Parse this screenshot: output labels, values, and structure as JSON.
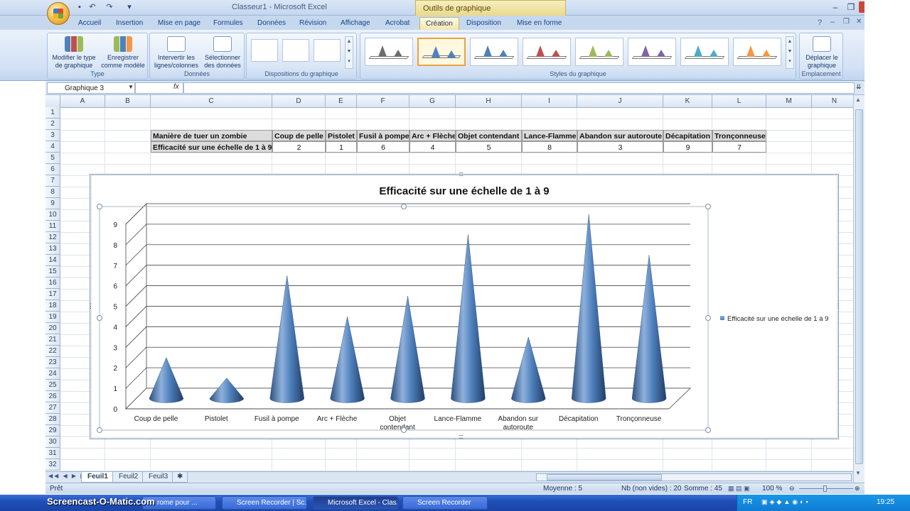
{
  "window": {
    "title": "Classeur1 - Microsoft Excel",
    "tools_title": "Outils de graphique"
  },
  "tabs": [
    "Accueil",
    "Insertion",
    "Mise en page",
    "Formules",
    "Données",
    "Révision",
    "Affichage",
    "Acrobat",
    "Création",
    "Disposition",
    "Mise en forme"
  ],
  "active_tab": "Création",
  "ribbon": {
    "type_group": {
      "label": "Type",
      "btn_change_type": "Modifier le type de graphique",
      "btn_save_template": "Enregistrer comme modèle"
    },
    "data_group": {
      "label": "Données",
      "btn_switch": "Intervertir les lignes/colonnes",
      "btn_select": "Sélectionner des données"
    },
    "layouts_group": {
      "label": "Dispositions du graphique"
    },
    "styles_group": {
      "label": "Styles du graphique",
      "cone_colors": [
        "#6e6e6e",
        "#4f81bd",
        "#4f81bd",
        "#c0504d",
        "#9bbb59",
        "#8064a2",
        "#4bacc6",
        "#f79646"
      ],
      "selected_index": 1
    },
    "location_group": {
      "label": "Emplacement",
      "btn_move": "Déplacer le graphique"
    }
  },
  "formula_bar": {
    "name_box": "Graphique 3",
    "fx": "fx",
    "formula": ""
  },
  "columns": [
    "A",
    "B",
    "C",
    "D",
    "E",
    "F",
    "G",
    "H",
    "I",
    "J",
    "K",
    "L",
    "M",
    "N"
  ],
  "rows": [
    "1",
    "2",
    "3",
    "4",
    "5",
    "6",
    "7",
    "8",
    "9",
    "10",
    "11",
    "12",
    "13",
    "14",
    "15",
    "16",
    "17",
    "18",
    "19",
    "20",
    "21",
    "22",
    "23",
    "24",
    "25",
    "26",
    "27",
    "28",
    "29",
    "30",
    "31",
    "32"
  ],
  "table": {
    "row3": [
      "Manière de tuer un zombie",
      "Coup de pelle",
      "Pistolet",
      "Fusil à pompe",
      "Arc + Flèche",
      "Objet contendant",
      "Lance-Flamme",
      "Abandon sur autoroute",
      "Décapitation",
      "Tronçonneuse"
    ],
    "row4": [
      "Efficacité sur une échelle de 1 à 9",
      "2",
      "1",
      "6",
      "4",
      "5",
      "8",
      "3",
      "9",
      "7"
    ]
  },
  "chart_data": {
    "type": "bar",
    "shape": "cone-3d",
    "title": "Efficacité sur une échelle de 1 à 9",
    "categories": [
      "Coup de pelle",
      "Pistolet",
      "Fusil à pompe",
      "Arc + Flèche",
      "Objet contendant",
      "Lance-Flamme",
      "Abandon sur autoroute",
      "Décapitation",
      "Tronçonneuse"
    ],
    "series": [
      {
        "name": "Efficacité sur une échelle de 1 à 9",
        "values": [
          2,
          1,
          6,
          4,
          5,
          8,
          3,
          9,
          7
        ]
      }
    ],
    "yticks": [
      "0",
      "1",
      "2",
      "3",
      "4",
      "5",
      "6",
      "7",
      "8",
      "9"
    ],
    "ylim": [
      0,
      9
    ],
    "grid": true,
    "legend": "right",
    "color": "#4f81bd"
  },
  "sheets": [
    "Feuil1",
    "Feuil2",
    "Feuil3"
  ],
  "active_sheet": "Feuil1",
  "status": {
    "ready": "Prêt",
    "average": "Moyenne : 5",
    "count": "Nb (non vides) : 20",
    "sum": "Somme : 45",
    "zoom": "100 %"
  },
  "taskbar": {
    "watermark": "Screencast-O-Matic.com",
    "items": [
      "rome pour ...",
      "Screen Recorder | Sc...",
      "Microsoft Excel - Clas...",
      "Screen Recorder"
    ],
    "active_index": 2,
    "lang": "FR",
    "clock": "19:25"
  }
}
